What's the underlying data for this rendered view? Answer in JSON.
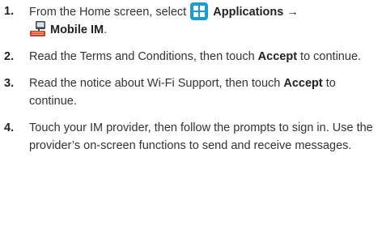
{
  "steps": [
    {
      "number": "1.",
      "text_before": "From the Home screen, select ",
      "apps_label": "Applications",
      "arrow": "→",
      "im_label": "Mobile IM",
      "end": ".",
      "icons": [
        "applications-grid-icon",
        "mobile-im-icon"
      ]
    },
    {
      "number": "2.",
      "text_before": "Read the Terms and Conditions, then touch ",
      "bold": "Accept",
      "text_after": " to continue."
    },
    {
      "number": "3.",
      "text_before": "Read the notice about Wi-Fi Support, then touch ",
      "bold": "Accept",
      "text_after": " to continue."
    },
    {
      "number": "4.",
      "text": "Touch your IM provider, then follow the prompts to sign in. Use the provider’s on-screen functions to send and receive messages."
    }
  ],
  "colors": {
    "text": "#333333",
    "apps_icon_bg": "#1a9ad6"
  }
}
